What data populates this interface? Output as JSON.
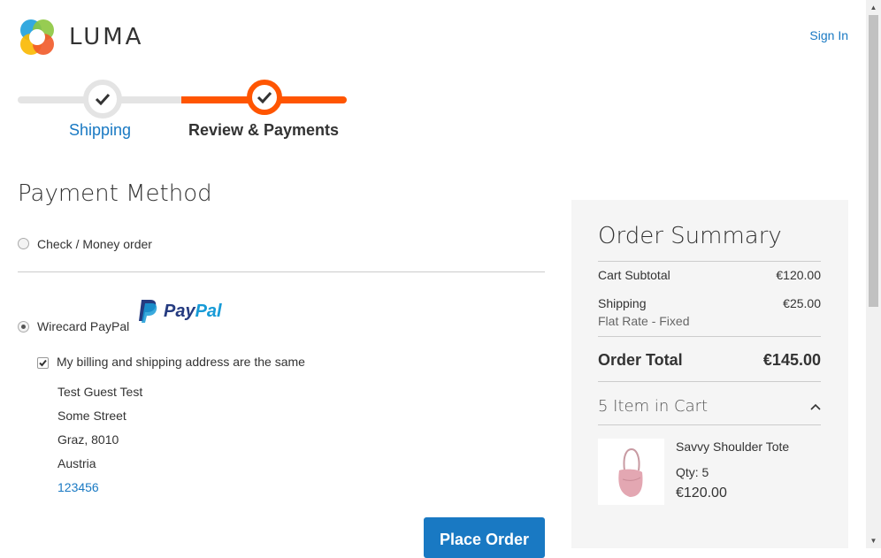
{
  "header": {
    "logo_text": "LUMA",
    "signin_label": "Sign In"
  },
  "progress": {
    "steps": [
      {
        "label": "Shipping",
        "state": "complete"
      },
      {
        "label": "Review & Payments",
        "state": "active"
      }
    ],
    "accent_color": "#ff5501"
  },
  "payment": {
    "title": "Payment Method",
    "options": [
      {
        "label": "Check / Money order",
        "selected": false
      },
      {
        "label": "Wirecard PayPal",
        "selected": true
      }
    ],
    "paypal_logo_text_1": "Pay",
    "paypal_logo_text_2": "Pal",
    "billing_same_label": "My billing and shipping address are the same",
    "billing_same_checked": true,
    "address": [
      "Test Guest Test",
      "Some Street",
      "Graz, 8010",
      "Austria"
    ],
    "phone": "123456",
    "place_order_label": "Place Order"
  },
  "summary": {
    "title": "Order Summary",
    "cart_subtotal_label": "Cart Subtotal",
    "cart_subtotal_value": "€120.00",
    "shipping_label": "Shipping",
    "shipping_method": "Flat Rate - Fixed",
    "shipping_value": "€25.00",
    "order_total_label": "Order Total",
    "order_total_value": "€145.00",
    "items_in_cart": "5 Item in Cart",
    "item": {
      "name": "Savvy Shoulder Tote",
      "qty": "Qty: 5",
      "price": "€120.00"
    }
  },
  "colors": {
    "link": "#1979c3",
    "button": "#1979c3",
    "accent": "#ff5501"
  }
}
